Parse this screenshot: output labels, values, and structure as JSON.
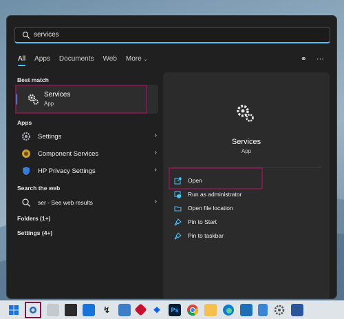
{
  "search": {
    "value": "services",
    "placeholder": ""
  },
  "tabs": [
    {
      "label": "All",
      "active": true
    },
    {
      "label": "Apps"
    },
    {
      "label": "Documents"
    },
    {
      "label": "Web"
    },
    {
      "label": "More"
    }
  ],
  "sections": {
    "best_match": "Best match",
    "apps": "Apps",
    "search_web": "Search the web",
    "folders": "Folders (1+)",
    "settings": "Settings (4+)"
  },
  "best_match": {
    "title": "Services",
    "subtitle": "App",
    "icon": "gear-icon"
  },
  "apps": [
    {
      "label": "Settings",
      "icon": "settings-gear-icon"
    },
    {
      "label": "Component Services",
      "icon": "component-services-icon"
    },
    {
      "label": "HP Privacy Settings",
      "icon": "hp-privacy-icon"
    }
  ],
  "web_search": {
    "label": "ser - See web results",
    "icon": "search-icon"
  },
  "detail": {
    "title": "Services",
    "subtitle": "App",
    "actions": [
      {
        "label": "Open",
        "icon": "open-icon"
      },
      {
        "label": "Run as administrator",
        "icon": "shield-icon"
      },
      {
        "label": "Open file location",
        "icon": "folder-icon"
      },
      {
        "label": "Pin to Start",
        "icon": "pin-icon"
      },
      {
        "label": "Pin to taskbar",
        "icon": "pin-icon"
      }
    ]
  },
  "taskbar": {
    "icons": [
      "windows-start-icon",
      "search-icon",
      "task-view-icon",
      "store-icon",
      "mail-icon",
      "terminal-icon",
      "monitor-icon",
      "app-icon",
      "dropbox-icon",
      "photoshop-icon",
      "chrome-icon",
      "folder-icon",
      "edge-icon",
      "vs-code-icon",
      "notepad-icon",
      "settings-icon",
      "word-icon"
    ],
    "photoshop_label": "Ps"
  },
  "colors": {
    "accent": "#4cc2ff",
    "highlight": "#7a1a4c",
    "panel": "#202020"
  }
}
